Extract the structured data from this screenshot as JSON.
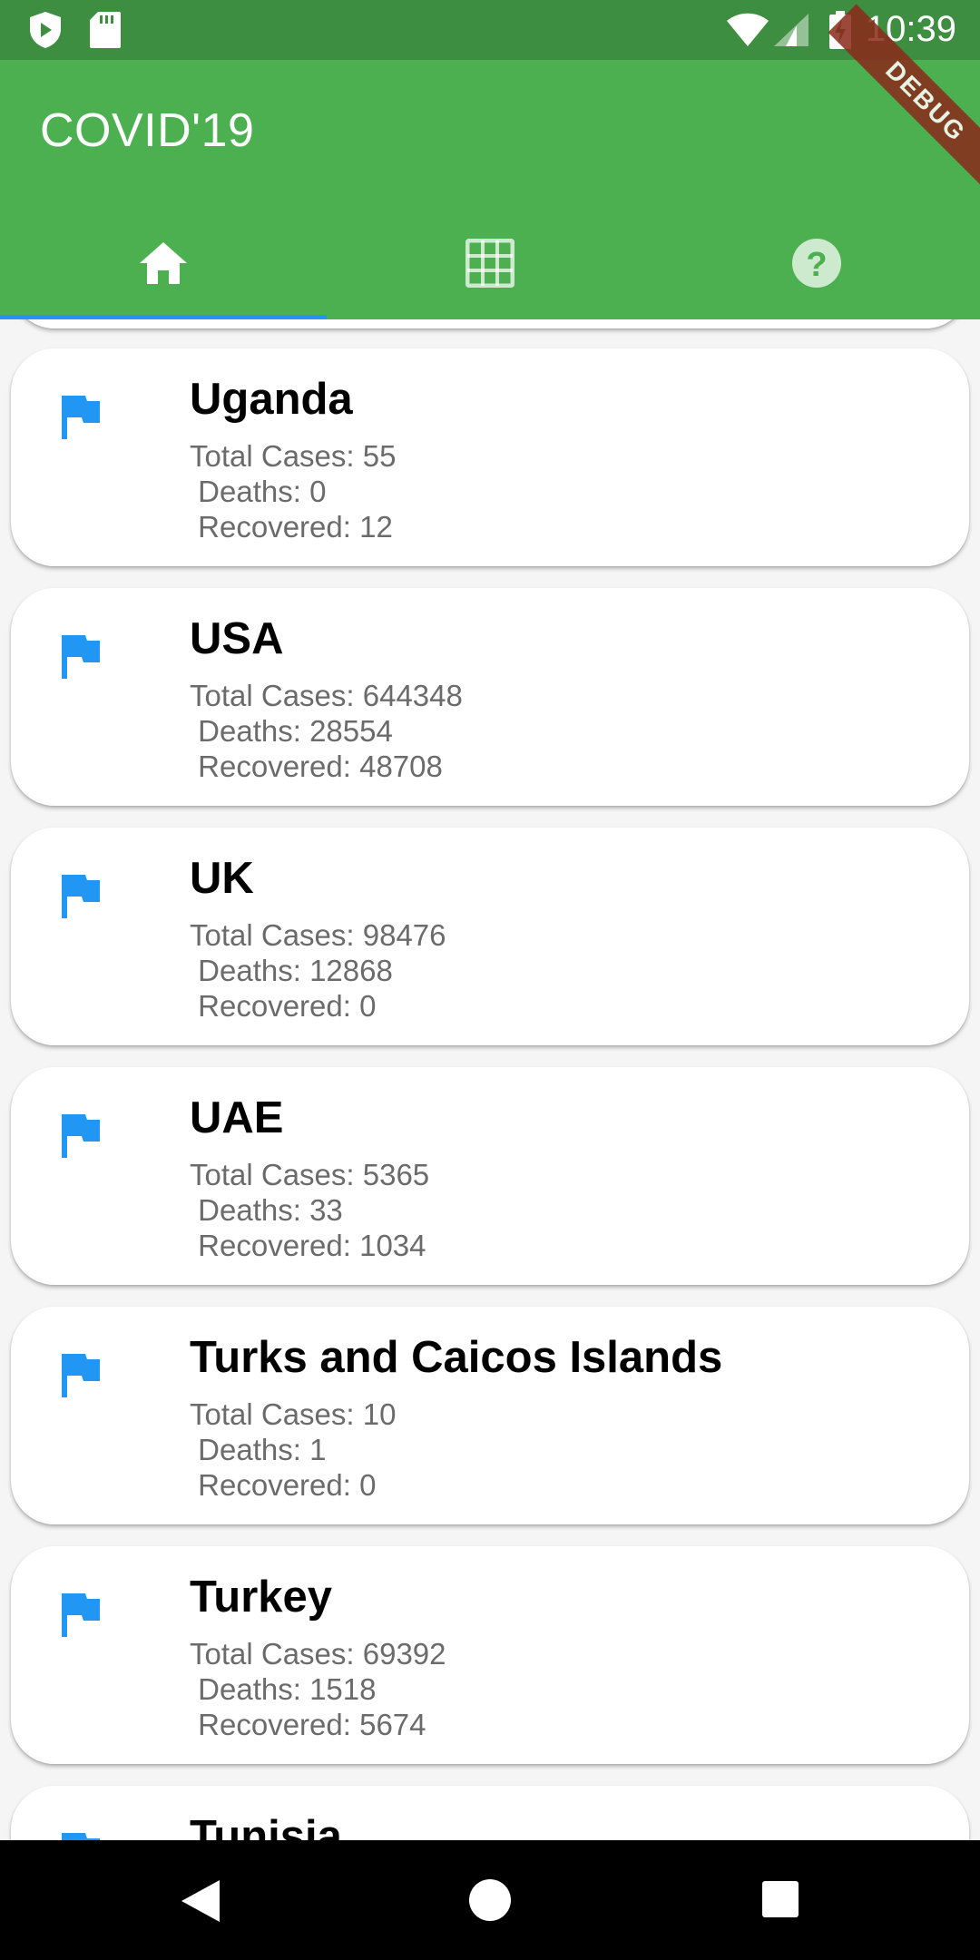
{
  "status_bar": {
    "time": "10:39",
    "icons": [
      "shield-play-icon",
      "sd-card-icon",
      "wifi-icon",
      "signal-icon",
      "battery-charging-icon"
    ]
  },
  "app_bar": {
    "title": "COVID'19",
    "debug_label": "DEBUG",
    "color": "#4caf50",
    "tabs": [
      {
        "icon": "home-icon",
        "selected": true
      },
      {
        "icon": "grid-icon",
        "selected": false
      },
      {
        "icon": "help-icon",
        "selected": false
      }
    ],
    "indicator_color": "#2196f3"
  },
  "countries": [
    {
      "name": "Uganda",
      "total": "Total Cases: 55",
      "deaths": " Deaths: 0",
      "recovered": " Recovered: 12"
    },
    {
      "name": "USA",
      "total": "Total Cases: 644348",
      "deaths": " Deaths: 28554",
      "recovered": " Recovered: 48708"
    },
    {
      "name": "UK",
      "total": "Total Cases: 98476",
      "deaths": " Deaths: 12868",
      "recovered": " Recovered: 0"
    },
    {
      "name": "UAE",
      "total": "Total Cases: 5365",
      "deaths": " Deaths: 33",
      "recovered": " Recovered: 1034"
    },
    {
      "name": "Turks and Caicos Islands",
      "total": "Total Cases: 10",
      "deaths": " Deaths: 1",
      "recovered": " Recovered: 0"
    },
    {
      "name": "Turkey",
      "total": "Total Cases: 69392",
      "deaths": " Deaths: 1518",
      "recovered": " Recovered: 5674"
    },
    {
      "name": "Tunisia",
      "total": "",
      "deaths": "",
      "recovered": ""
    }
  ],
  "flag_icon": "flag-icon",
  "flag_color": "#2196f3",
  "nav_bar": {
    "buttons": [
      "back-icon",
      "home-circle-icon",
      "recents-icon"
    ]
  }
}
